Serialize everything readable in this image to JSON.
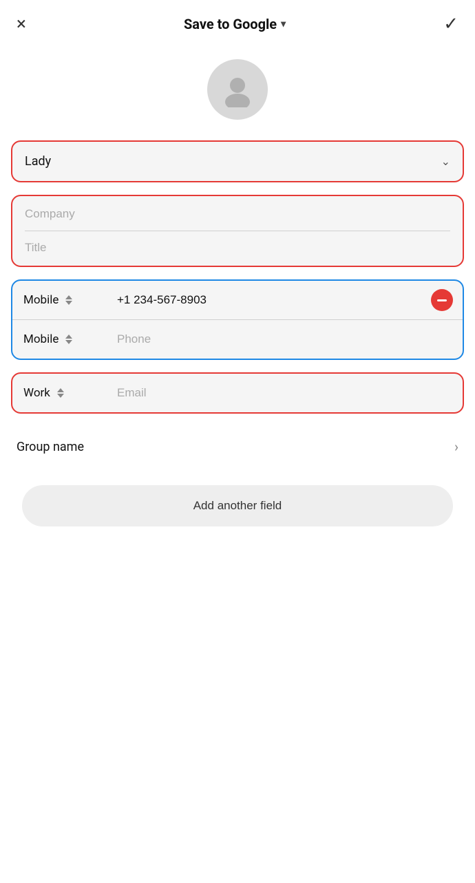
{
  "header": {
    "close_label": "×",
    "title": "Save to Google",
    "dropdown_arrow": "▾",
    "confirm_label": "✓"
  },
  "avatar": {
    "aria_label": "Contact avatar placeholder"
  },
  "name_field": {
    "value": "Lady",
    "dropdown_arrow": "⌄"
  },
  "company_field": {
    "company_placeholder": "Company",
    "title_placeholder": "Title"
  },
  "phone_section": {
    "rows": [
      {
        "label": "Mobile",
        "value": "+1 234-567-8903",
        "placeholder": "",
        "has_remove": true
      },
      {
        "label": "Mobile",
        "value": "",
        "placeholder": "Phone",
        "has_remove": false
      }
    ]
  },
  "email_section": {
    "label": "Work",
    "placeholder": "Email"
  },
  "group_name": {
    "label": "Group name",
    "chevron": "›"
  },
  "add_field_btn": {
    "label": "Add another field"
  }
}
